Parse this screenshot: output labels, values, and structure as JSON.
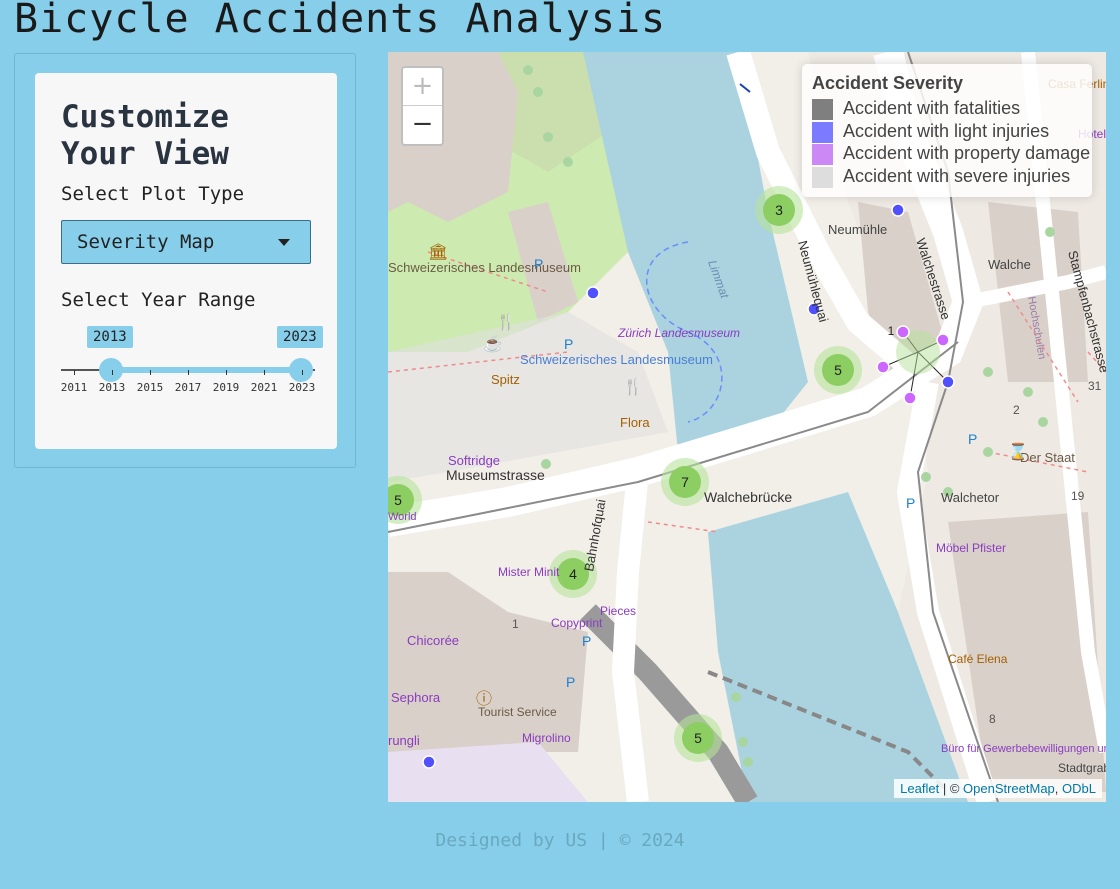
{
  "app": {
    "title": "Bicycle Accidents Analysis"
  },
  "sidebar": {
    "heading": "Customize Your View",
    "plot_type_label": "Select Plot Type",
    "plot_type_value": "Severity Map",
    "year_label": "Select Year Range",
    "year_min_label": "2013",
    "year_max_label": "2023",
    "year_ticks": [
      "2011",
      "2013",
      "2015",
      "2017",
      "2019",
      "2021",
      "2023"
    ]
  },
  "map": {
    "zoom_in": "+",
    "zoom_out": "−",
    "legend": {
      "title": "Accident Severity",
      "items": [
        {
          "label": "Accident with fatalities",
          "color": "#7f7f7f"
        },
        {
          "label": "Accident with light injuries",
          "color": "#7b7bff"
        },
        {
          "label": "Accident with property damage",
          "color": "#cc88f5"
        },
        {
          "label": "Accident with severe injuries",
          "color": "#dddddd"
        }
      ]
    },
    "clusters": [
      "3",
      "5",
      "7",
      "5",
      "4",
      "5"
    ],
    "spider_count": "1",
    "labels": {
      "museum": "Schweizerisches Landesmuseum",
      "museum2": "Schweizerisches Landesmuseum",
      "zurich_museum": "Zürich Landesmuseum",
      "limmat": "Limmat",
      "neumuhle": "Neumühle",
      "neumuhlequai": "Neumühlequai",
      "walchestrasse": "Walchestrasse",
      "walche": "Walche",
      "stampfenbachstrasse": "Stampfenbachstrasse",
      "hochschulen": "Hochschulen",
      "spitz": "Spitz",
      "flora": "Flora",
      "softridge": "Softridge",
      "museumstrasse": "Museumstrasse",
      "walchebrucke": "Walchebrücke",
      "bahnhofquai": "Bahnhofquai",
      "walchetor": "Walchetor",
      "der_staat": "Der Staat",
      "mobel_pfister": "Möbel Pfister",
      "mister_minit": "Mister Minit",
      "pieces": "Pieces",
      "copyprint": "Copyprint",
      "chicoree": "Chicorée",
      "sephora": "Sephora",
      "tourist_service": "Tourist Service",
      "migrolino": "Migrolino",
      "cafe_elena": "Café Elena",
      "buro": "Büro für Gewerbebewilligungen und Beglaubigungen",
      "casa_ferlin": "Casa Ferlin",
      "hotel_bristol": "Hotel Bristol",
      "rungli": "rungli",
      "world": "World",
      "num_19": "19",
      "num_2": "2",
      "num_1": "1",
      "num_8": "8",
      "num_31": "31",
      "stadtgraben": "Stadtgraben"
    },
    "attribution": {
      "leaflet": "Leaflet",
      "sep": " | © ",
      "osm": "OpenStreetMap",
      "odbl": "ODbL"
    }
  },
  "footer": {
    "text": "Designed by US | © 2024"
  }
}
